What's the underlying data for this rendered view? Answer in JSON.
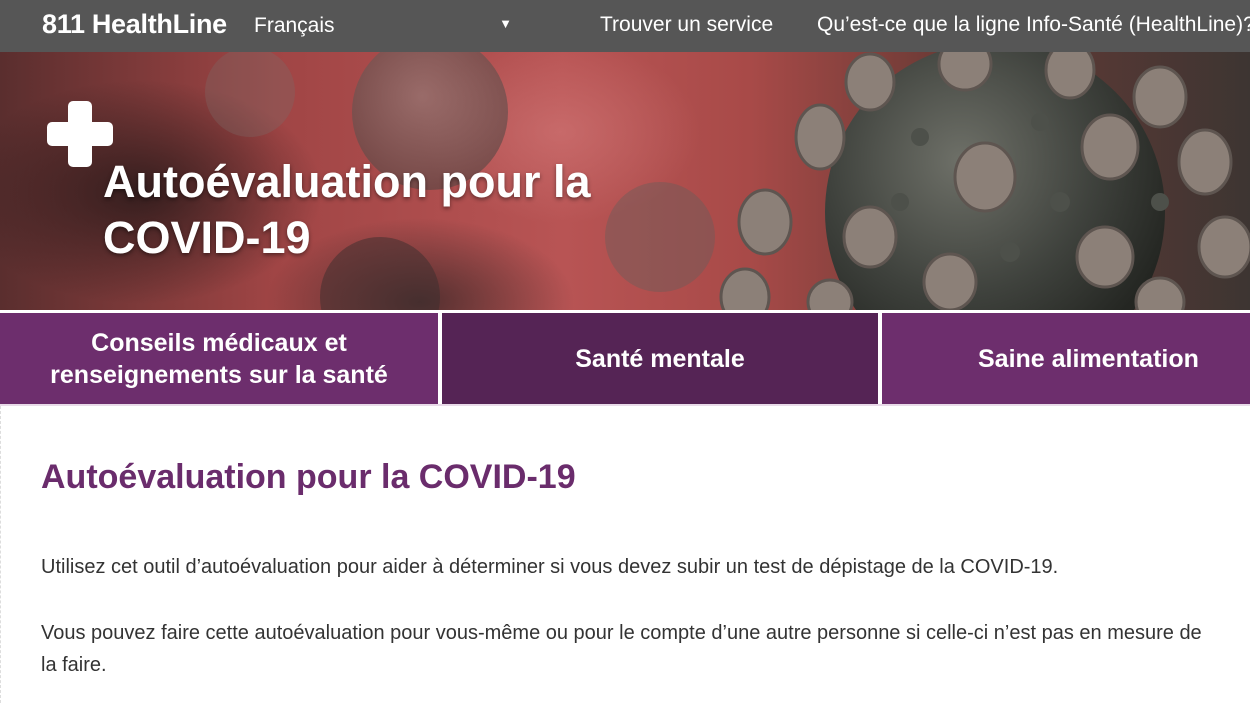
{
  "topbar": {
    "brand": "811 HealthLine",
    "language": "Français",
    "nav": {
      "find_service": "Trouver un service",
      "what_is": "Qu’est-ce que la ligne Info-Santé (HealthLine)?"
    }
  },
  "hero": {
    "title_line1": "Autoévaluation pour la",
    "title_line2": "COVID-19"
  },
  "tabs": [
    {
      "line1": "Conseils médicaux et",
      "line2": "renseignements sur la santé"
    },
    {
      "label": "Santé mentale"
    },
    {
      "label": "Saine alimentation"
    }
  ],
  "main": {
    "title": "Autoévaluation pour la COVID-19",
    "paragraphs": [
      "Utilisez cet outil d’autoévaluation pour aider à déterminer si vous devez subir un test de dépistage de la COVID-19.",
      "Vous pouvez faire cette autoévaluation pour vous-même ou pour le compte d’une autre personne si celle-ci n’est pas en mesure de",
      "la faire."
    ]
  },
  "colors": {
    "topbar": "#565656",
    "tab_purple": "#6d2e6d",
    "tab_active": "#552455",
    "title_purple": "#6a2c6c"
  }
}
